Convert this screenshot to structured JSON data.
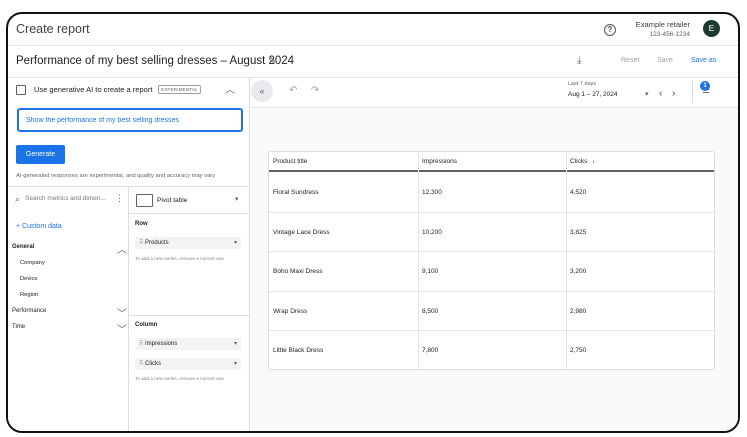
{
  "appbar": {
    "title": "Create report",
    "help_icon": "?",
    "account_name": "Example retailer",
    "account_id": "123-456-1234",
    "avatar_initial": "E"
  },
  "titlebar": {
    "report_title": "Performance of my best selling dresses – August 2024",
    "reset_label": "Reset",
    "save_label": "Save",
    "save_as_label": "Save as"
  },
  "ai_panel": {
    "title": "Use generative AI to create a report",
    "badge": "EXPERIMENTAL",
    "prompt_value": "Show the performance of my best selling dresses",
    "generate_label": "Generate",
    "disclaimer": "AI-generated responses are experimental, and quality and accuracy may vary"
  },
  "metrics_panel": {
    "search_placeholder": "Search metrics and dimen...",
    "custom_data_label": "+ Custom data",
    "categories": [
      {
        "label": "General",
        "items": [
          "Company",
          "Device",
          "Region"
        ]
      },
      {
        "label": "Performance"
      },
      {
        "label": "Time"
      }
    ]
  },
  "pivot_panel": {
    "type_label": "Pivot table",
    "row_label": "Row",
    "row_chips": [
      "Products"
    ],
    "row_hint": "To add a new series, remove a current one",
    "column_label": "Column",
    "column_chips": [
      "Impressions",
      "Clicks"
    ],
    "column_hint": "To add a new series, remove a current one"
  },
  "toolbar": {
    "date_caption": "Last 7 days",
    "date_range": "Aug 1 – 27, 2024",
    "filter_badge": "1"
  },
  "table": {
    "headers": [
      "Product title",
      "Impressions",
      "Clicks"
    ],
    "sort_indicator": "↓",
    "rows": [
      [
        "Floral Sundress",
        "12,300",
        "4,520"
      ],
      [
        "Vintage Lace Dress",
        "10,200",
        "3,825"
      ],
      [
        "Boho Maxi Dress",
        "9,100",
        "3,200"
      ],
      [
        "Wrap Dress",
        "8,500",
        "2,980"
      ],
      [
        "Little Black Dress",
        "7,800",
        "2,750"
      ]
    ]
  }
}
